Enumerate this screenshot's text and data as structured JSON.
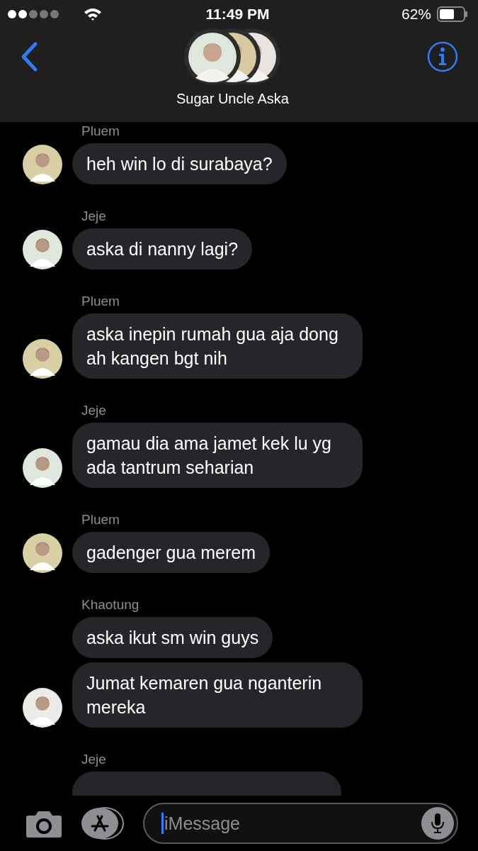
{
  "status_bar": {
    "time": "11:49 PM",
    "battery": "62%"
  },
  "header": {
    "title": "Sugar Uncle Aska"
  },
  "groups": [
    {
      "sender": "Pluem",
      "color": "#d8cfa4",
      "messages": [
        {
          "kind": "text",
          "text": "heh win lo di surabaya?"
        }
      ]
    },
    {
      "sender": "Jeje",
      "color": "#dfe8dc",
      "messages": [
        {
          "kind": "text",
          "text": "aska di nanny lagi?"
        }
      ]
    },
    {
      "sender": "Pluem",
      "color": "#d8cfa4",
      "messages": [
        {
          "kind": "text",
          "text": "aska inepin rumah gua aja dong ah kangen bgt nih"
        }
      ]
    },
    {
      "sender": "Jeje",
      "color": "#dfe8dc",
      "messages": [
        {
          "kind": "text",
          "text": "gamau dia ama jamet kek lu yg ada tantrum seharian"
        }
      ]
    },
    {
      "sender": "Pluem",
      "color": "#d8cfa4",
      "messages": [
        {
          "kind": "text",
          "text": "gadenger gua merem"
        }
      ]
    },
    {
      "sender": "Khaotung",
      "color": "#ecebe8",
      "messages": [
        {
          "kind": "text",
          "text": "aska ikut sm win guys"
        },
        {
          "kind": "text",
          "text": "Jumat kemaren gua nganterin mereka"
        }
      ]
    },
    {
      "sender": "Jeje",
      "messages": [
        {
          "kind": "clipped"
        }
      ]
    }
  ],
  "composer": {
    "placeholder": "iMessage"
  }
}
